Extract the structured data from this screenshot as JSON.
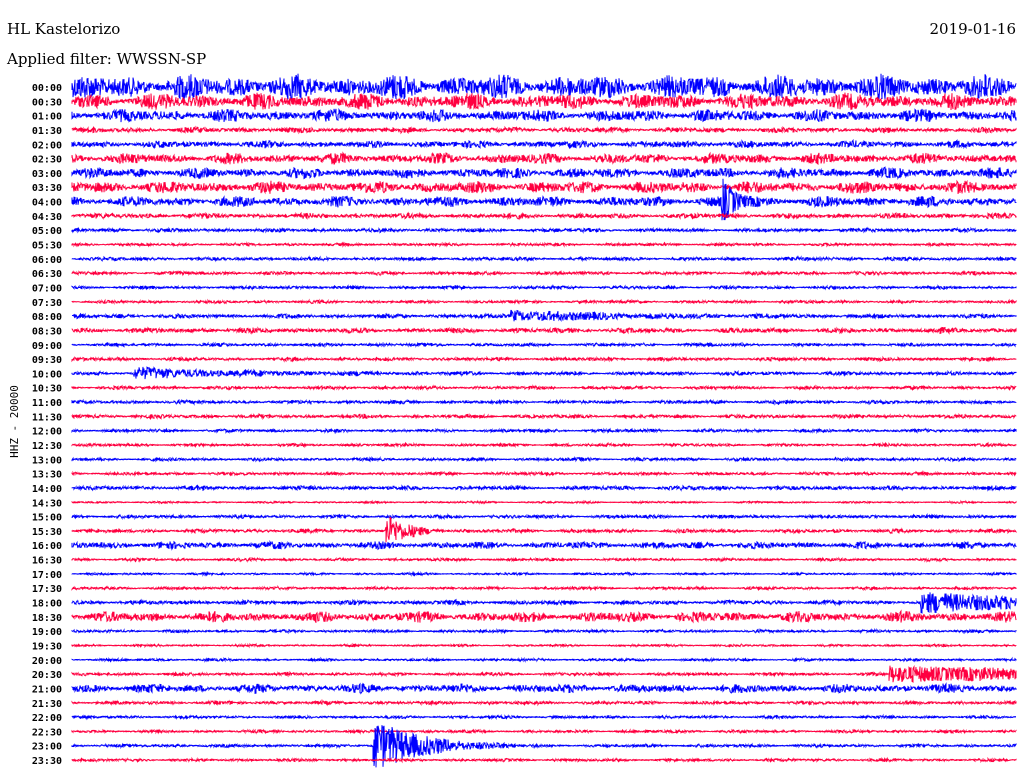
{
  "header": {
    "station": "HL Kastelorizo",
    "date": "2019-01-16",
    "filter": "Applied filter: WWSSN-SP"
  },
  "chart_data": {
    "type": "line",
    "title": "HL Kastelorizo",
    "ylabel": "HHZ - 20000",
    "xlabel": "",
    "minutes_per_line": 30,
    "colors": [
      "#0000ff",
      "#ff0040"
    ],
    "row_labels": [
      "00:00",
      "00:30",
      "01:00",
      "01:30",
      "02:00",
      "02:30",
      "03:00",
      "03:30",
      "04:00",
      "04:30",
      "05:00",
      "05:30",
      "06:00",
      "06:30",
      "07:00",
      "07:30",
      "08:00",
      "08:30",
      "09:00",
      "09:30",
      "10:00",
      "10:30",
      "11:00",
      "11:30",
      "12:00",
      "12:30",
      "13:00",
      "13:30",
      "14:00",
      "14:30",
      "15:00",
      "15:30",
      "16:00",
      "16:30",
      "17:00",
      "17:30",
      "18:00",
      "18:30",
      "19:00",
      "19:30",
      "20:00",
      "20:30",
      "21:00",
      "21:30",
      "22:00",
      "22:30",
      "23:00",
      "23:30"
    ],
    "noise_amplitude": [
      14,
      9,
      7,
      3,
      4,
      6,
      6,
      7,
      6,
      3,
      2.2,
      1.6,
      2,
      2,
      1.8,
      1.6,
      2.5,
      3,
      1.8,
      2,
      2.2,
      1.8,
      2,
      2.2,
      1.8,
      1.6,
      1.8,
      1.8,
      2.5,
      1,
      2,
      2.2,
      4,
      1.6,
      1.2,
      1.6,
      2.5,
      6,
      1.6,
      1.2,
      1.4,
      1.8,
      5,
      2,
      1.6,
      1.6,
      1.8,
      1.6
    ],
    "events": [
      {
        "row": 8,
        "minute": 20.7,
        "amplitude": 18,
        "duration": 0.4
      },
      {
        "row": 31,
        "minute": 10,
        "amplitude": 16,
        "duration": 0.6
      },
      {
        "row": 36,
        "minute": 27,
        "amplitude": 9,
        "duration": 6
      },
      {
        "row": 41,
        "minute": 26,
        "amplitude": 8,
        "duration": 8
      },
      {
        "row": 46,
        "minute": 9.6,
        "amplitude": 26,
        "duration": 1.5
      },
      {
        "row": 16,
        "minute": 14,
        "amplitude": 5,
        "duration": 3
      },
      {
        "row": 20,
        "minute": 2,
        "amplitude": 5,
        "duration": 3
      }
    ]
  }
}
